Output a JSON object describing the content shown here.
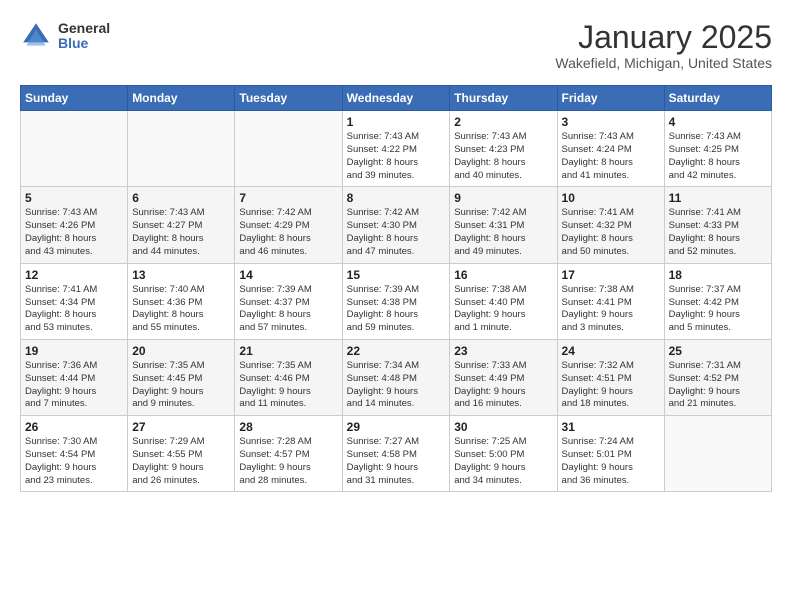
{
  "logo": {
    "general": "General",
    "blue": "Blue"
  },
  "header": {
    "month": "January 2025",
    "location": "Wakefield, Michigan, United States"
  },
  "weekdays": [
    "Sunday",
    "Monday",
    "Tuesday",
    "Wednesday",
    "Thursday",
    "Friday",
    "Saturday"
  ],
  "weeks": [
    [
      {
        "day": "",
        "info": ""
      },
      {
        "day": "",
        "info": ""
      },
      {
        "day": "",
        "info": ""
      },
      {
        "day": "1",
        "info": "Sunrise: 7:43 AM\nSunset: 4:22 PM\nDaylight: 8 hours\nand 39 minutes."
      },
      {
        "day": "2",
        "info": "Sunrise: 7:43 AM\nSunset: 4:23 PM\nDaylight: 8 hours\nand 40 minutes."
      },
      {
        "day": "3",
        "info": "Sunrise: 7:43 AM\nSunset: 4:24 PM\nDaylight: 8 hours\nand 41 minutes."
      },
      {
        "day": "4",
        "info": "Sunrise: 7:43 AM\nSunset: 4:25 PM\nDaylight: 8 hours\nand 42 minutes."
      }
    ],
    [
      {
        "day": "5",
        "info": "Sunrise: 7:43 AM\nSunset: 4:26 PM\nDaylight: 8 hours\nand 43 minutes."
      },
      {
        "day": "6",
        "info": "Sunrise: 7:43 AM\nSunset: 4:27 PM\nDaylight: 8 hours\nand 44 minutes."
      },
      {
        "day": "7",
        "info": "Sunrise: 7:42 AM\nSunset: 4:29 PM\nDaylight: 8 hours\nand 46 minutes."
      },
      {
        "day": "8",
        "info": "Sunrise: 7:42 AM\nSunset: 4:30 PM\nDaylight: 8 hours\nand 47 minutes."
      },
      {
        "day": "9",
        "info": "Sunrise: 7:42 AM\nSunset: 4:31 PM\nDaylight: 8 hours\nand 49 minutes."
      },
      {
        "day": "10",
        "info": "Sunrise: 7:41 AM\nSunset: 4:32 PM\nDaylight: 8 hours\nand 50 minutes."
      },
      {
        "day": "11",
        "info": "Sunrise: 7:41 AM\nSunset: 4:33 PM\nDaylight: 8 hours\nand 52 minutes."
      }
    ],
    [
      {
        "day": "12",
        "info": "Sunrise: 7:41 AM\nSunset: 4:34 PM\nDaylight: 8 hours\nand 53 minutes."
      },
      {
        "day": "13",
        "info": "Sunrise: 7:40 AM\nSunset: 4:36 PM\nDaylight: 8 hours\nand 55 minutes."
      },
      {
        "day": "14",
        "info": "Sunrise: 7:39 AM\nSunset: 4:37 PM\nDaylight: 8 hours\nand 57 minutes."
      },
      {
        "day": "15",
        "info": "Sunrise: 7:39 AM\nSunset: 4:38 PM\nDaylight: 8 hours\nand 59 minutes."
      },
      {
        "day": "16",
        "info": "Sunrise: 7:38 AM\nSunset: 4:40 PM\nDaylight: 9 hours\nand 1 minute."
      },
      {
        "day": "17",
        "info": "Sunrise: 7:38 AM\nSunset: 4:41 PM\nDaylight: 9 hours\nand 3 minutes."
      },
      {
        "day": "18",
        "info": "Sunrise: 7:37 AM\nSunset: 4:42 PM\nDaylight: 9 hours\nand 5 minutes."
      }
    ],
    [
      {
        "day": "19",
        "info": "Sunrise: 7:36 AM\nSunset: 4:44 PM\nDaylight: 9 hours\nand 7 minutes."
      },
      {
        "day": "20",
        "info": "Sunrise: 7:35 AM\nSunset: 4:45 PM\nDaylight: 9 hours\nand 9 minutes."
      },
      {
        "day": "21",
        "info": "Sunrise: 7:35 AM\nSunset: 4:46 PM\nDaylight: 9 hours\nand 11 minutes."
      },
      {
        "day": "22",
        "info": "Sunrise: 7:34 AM\nSunset: 4:48 PM\nDaylight: 9 hours\nand 14 minutes."
      },
      {
        "day": "23",
        "info": "Sunrise: 7:33 AM\nSunset: 4:49 PM\nDaylight: 9 hours\nand 16 minutes."
      },
      {
        "day": "24",
        "info": "Sunrise: 7:32 AM\nSunset: 4:51 PM\nDaylight: 9 hours\nand 18 minutes."
      },
      {
        "day": "25",
        "info": "Sunrise: 7:31 AM\nSunset: 4:52 PM\nDaylight: 9 hours\nand 21 minutes."
      }
    ],
    [
      {
        "day": "26",
        "info": "Sunrise: 7:30 AM\nSunset: 4:54 PM\nDaylight: 9 hours\nand 23 minutes."
      },
      {
        "day": "27",
        "info": "Sunrise: 7:29 AM\nSunset: 4:55 PM\nDaylight: 9 hours\nand 26 minutes."
      },
      {
        "day": "28",
        "info": "Sunrise: 7:28 AM\nSunset: 4:57 PM\nDaylight: 9 hours\nand 28 minutes."
      },
      {
        "day": "29",
        "info": "Sunrise: 7:27 AM\nSunset: 4:58 PM\nDaylight: 9 hours\nand 31 minutes."
      },
      {
        "day": "30",
        "info": "Sunrise: 7:25 AM\nSunset: 5:00 PM\nDaylight: 9 hours\nand 34 minutes."
      },
      {
        "day": "31",
        "info": "Sunrise: 7:24 AM\nSunset: 5:01 PM\nDaylight: 9 hours\nand 36 minutes."
      },
      {
        "day": "",
        "info": ""
      }
    ]
  ]
}
